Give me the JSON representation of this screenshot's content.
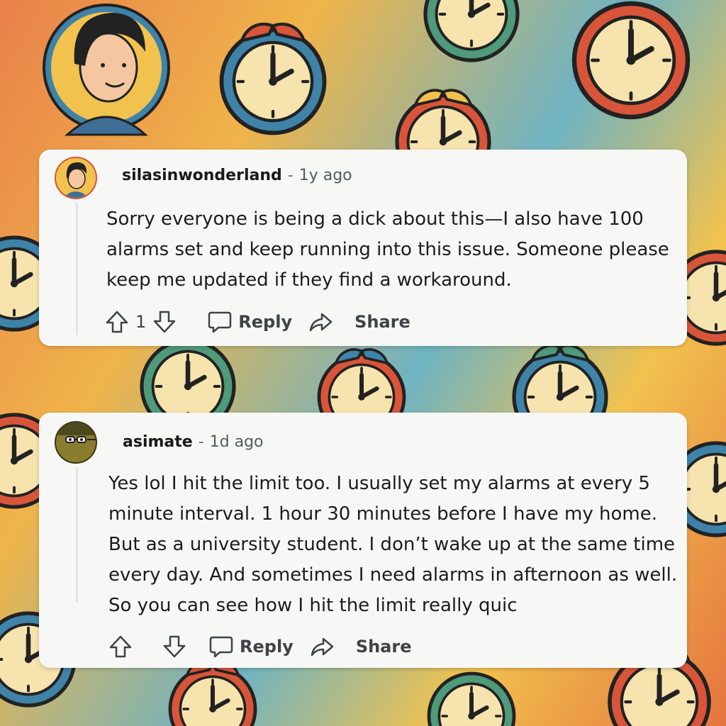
{
  "comments": [
    {
      "username": "silasinwonderland",
      "separator": "-",
      "age": "1y ago",
      "lines": [
        "Sorry everyone is being a dick about this—I also have 100",
        "alarms set and keep running into this issue. Someone please",
        "keep me updated if they find a workaround."
      ],
      "score": "1",
      "reply_label": "Reply",
      "share_label": "Share"
    },
    {
      "username": "asimate",
      "separator": "-",
      "age": "1d ago",
      "lines": [
        "Yes lol I hit the limit too. I usually set my alarms at every 5",
        "minute interval. 1 hour 30 minutes before I have my home.",
        "But as a university student. I don’t wake up at the same time",
        "every day. And sometimes I need alarms in afternoon as well.",
        "So you can see how I hit the limit really quic"
      ],
      "reply_label": "Reply",
      "share_label": "Share"
    }
  ],
  "icons": {
    "upvote": "arrow-up-icon",
    "downvote": "arrow-down-icon",
    "reply": "speech-bubble-icon",
    "share": "share-arrow-icon"
  },
  "colors": {
    "card": "#f7f7f6",
    "text": "#1c1c1c",
    "action": "#3f4347",
    "clock_red": "#d9553a",
    "clock_blue": "#3f83a8",
    "clock_green": "#4e9a7a",
    "clock_yellow": "#f2c24e",
    "clock_face": "#f6e3ad"
  }
}
